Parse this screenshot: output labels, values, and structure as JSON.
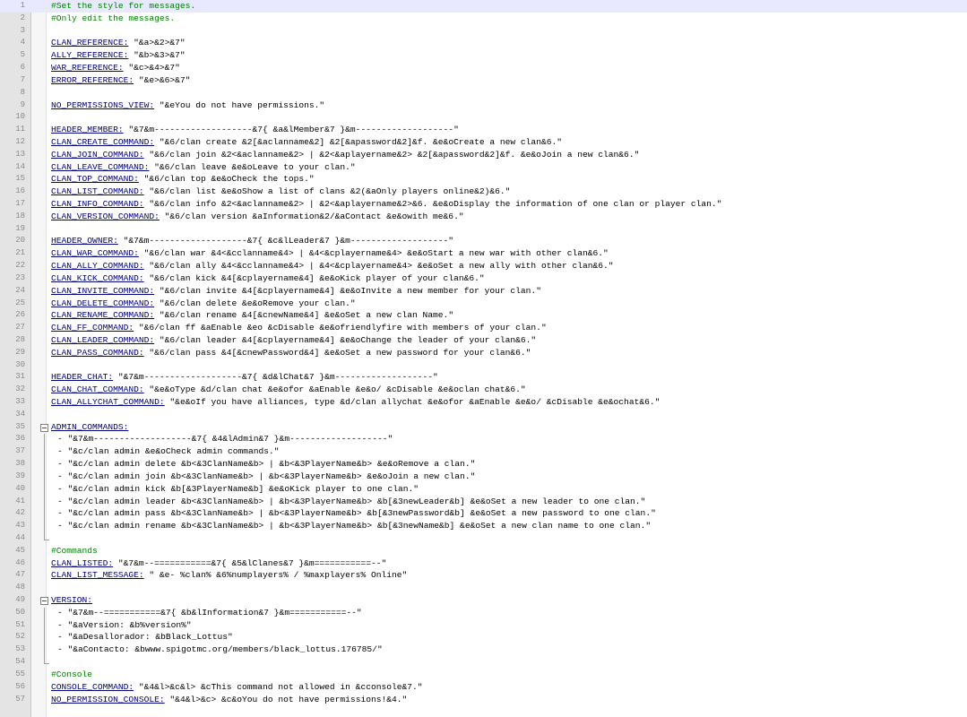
{
  "colors": {
    "comment": "#008000",
    "key": "#000080",
    "text": "#000000",
    "current_line": "#e8e8ff",
    "gutter": "#e4e4e4"
  },
  "lines": [
    {
      "n": "1",
      "type": "comment",
      "text": "#Set the style for messages.",
      "current": true
    },
    {
      "n": "2",
      "type": "comment",
      "text": "#Only edit the messages."
    },
    {
      "n": "3",
      "type": "blank",
      "text": ""
    },
    {
      "n": "4",
      "type": "kv",
      "key": "CLAN_REFERENCE:",
      "value": " \"&a>&2>&7\""
    },
    {
      "n": "5",
      "type": "kv",
      "key": "ALLY_REFERENCE:",
      "value": " \"&b>&3>&7\""
    },
    {
      "n": "6",
      "type": "kv",
      "key": "WAR_REFERENCE:",
      "value": " \"&c>&4>&7\""
    },
    {
      "n": "7",
      "type": "kv",
      "key": "ERROR_REFERENCE:",
      "value": " \"&e>&6>&7\""
    },
    {
      "n": "8",
      "type": "blank",
      "text": ""
    },
    {
      "n": "9",
      "type": "kv",
      "key": "NO_PERMISSIONS_VIEW:",
      "value": " \"&eYou do not have permissions.\""
    },
    {
      "n": "10",
      "type": "blank",
      "text": ""
    },
    {
      "n": "11",
      "type": "kv",
      "key": "HEADER_MEMBER:",
      "value": " \"&7&m-------------------&7{ &a&lMember&7 }&m-------------------\""
    },
    {
      "n": "12",
      "type": "kv",
      "key": "CLAN_CREATE_COMMAND:",
      "value": " \"&6/clan create &2[&aclanname&2] &2[&apassword&2]&f. &e&oCreate a new clan&6.\""
    },
    {
      "n": "13",
      "type": "kv",
      "key": "CLAN_JOIN_COMMAND:",
      "value": " \"&6/clan join &2<&aclanname&2> | &2<&aplayername&2> &2[&apassword&2]&f. &e&oJoin a new clan&6.\""
    },
    {
      "n": "14",
      "type": "kv",
      "key": "CLAN_LEAVE_COMMAND:",
      "value": " \"&6/clan leave &e&oLeave to your clan.\""
    },
    {
      "n": "15",
      "type": "kv",
      "key": "CLAN_TOP_COMMAND:",
      "value": " \"&6/clan top &e&oCheck the tops.\""
    },
    {
      "n": "16",
      "type": "kv",
      "key": "CLAN_LIST_COMMAND:",
      "value": " \"&6/clan list &e&oShow a list of clans &2(&aOnly players online&2)&6.\""
    },
    {
      "n": "17",
      "type": "kv",
      "key": "CLAN_INFO_COMMAND:",
      "value": " \"&6/clan info &2<&aclanname&2> | &2<&aplayername&2>&6. &e&oDisplay the information of one clan or player clan.\""
    },
    {
      "n": "18",
      "type": "kv",
      "key": "CLAN_VERSION_COMMAND:",
      "value": " \"&6/clan version &aInformation&2/&aContact &e&owith me&6.\""
    },
    {
      "n": "19",
      "type": "blank",
      "text": ""
    },
    {
      "n": "20",
      "type": "kv",
      "key": "HEADER_OWNER:",
      "value": " \"&7&m-------------------&7{ &c&lLeader&7 }&m-------------------\""
    },
    {
      "n": "21",
      "type": "kv",
      "key": "CLAN_WAR_COMMAND:",
      "value": " \"&6/clan war &4<&cclanname&4> | &4<&cplayername&4> &e&oStart a new war with other clan&6.\""
    },
    {
      "n": "22",
      "type": "kv",
      "key": "CLAN_ALLY_COMMAND:",
      "value": " \"&6/clan ally &4<&cclanname&4> | &4<&cplayername&4> &e&oSet a new ally with other clan&6.\""
    },
    {
      "n": "23",
      "type": "kv",
      "key": "CLAN_KICK_COMMAND:",
      "value": " \"&6/clan kick &4[&cplayername&4] &e&oKick player of your clan&6.\""
    },
    {
      "n": "24",
      "type": "kv",
      "key": "CLAN_INVITE_COMMAND:",
      "value": " \"&6/clan invite &4[&cplayername&4] &e&oInvite a new member for your clan.\""
    },
    {
      "n": "25",
      "type": "kv",
      "key": "CLAN_DELETE_COMMAND:",
      "value": " \"&6/clan delete &e&oRemove your clan.\""
    },
    {
      "n": "26",
      "type": "kv",
      "key": "CLAN_RENAME_COMMAND:",
      "value": " \"&6/clan rename &4[&cnewName&4] &e&oSet a new clan Name.\""
    },
    {
      "n": "27",
      "type": "kv",
      "key": "CLAN_FF_COMMAND:",
      "value": " \"&6/clan ff &aEnable &eo &cDisable &e&ofriendlyfire with members of your clan.\""
    },
    {
      "n": "28",
      "type": "kv",
      "key": "CLAN_LEADER_COMMAND:",
      "value": " \"&6/clan leader &4[&cplayername&4] &e&oChange the leader of your clan&6.\""
    },
    {
      "n": "29",
      "type": "kv",
      "key": "CLAN_PASS_COMMAND:",
      "value": " \"&6/clan pass &4[&cnewPassword&4] &e&oSet a new password for your clan&6.\""
    },
    {
      "n": "30",
      "type": "blank",
      "text": ""
    },
    {
      "n": "31",
      "type": "kv",
      "key": "HEADER_CHAT:",
      "value": " \"&7&m-------------------&7{ &d&lChat&7 }&m-------------------\""
    },
    {
      "n": "32",
      "type": "kv",
      "key": "CLAN_CHAT_COMMAND:",
      "value": " \"&e&oType &d/clan chat &e&ofor &aEnable &e&o/ &cDisable &e&oclan chat&6.\""
    },
    {
      "n": "33",
      "type": "kv",
      "key": "CLAN_ALLYCHAT_COMMAND:",
      "value": " \"&e&oIf you have alliances, type &d/clan allychat &e&ofor &aEnable &e&o/ &cDisable &e&ochat&6.\""
    },
    {
      "n": "34",
      "type": "blank",
      "text": ""
    },
    {
      "n": "35",
      "type": "fold",
      "key": "ADMIN_COMMANDS:",
      "value": ""
    },
    {
      "n": "36",
      "type": "item",
      "text": "- \"&7&m-------------------&7{ &4&lAdmin&7 }&m-------------------\""
    },
    {
      "n": "37",
      "type": "item",
      "text": "- \"&c/clan admin &e&oCheck admin commands.\""
    },
    {
      "n": "38",
      "type": "item",
      "text": "- \"&c/clan admin delete &b<&3ClanName&b> | &b<&3PlayerName&b> &e&oRemove a clan.\""
    },
    {
      "n": "39",
      "type": "item",
      "text": "- \"&c/clan admin join &b<&3ClanName&b> | &b<&3PlayerName&b> &e&oJoin a new clan.\""
    },
    {
      "n": "40",
      "type": "item",
      "text": "- \"&c/clan admin kick &b[&3PlayerName&b] &e&oKick player to one clan.\""
    },
    {
      "n": "41",
      "type": "item",
      "text": "- \"&c/clan admin leader &b<&3ClanName&b> | &b<&3PlayerName&b> &b[&3newLeader&b] &e&oSet a new leader to one clan.\""
    },
    {
      "n": "42",
      "type": "item",
      "text": "- \"&c/clan admin pass &b<&3ClanName&b> | &b<&3PlayerName&b> &b[&3newPassword&b] &e&oSet a new password to one clan.\""
    },
    {
      "n": "43",
      "type": "item",
      "text": "- \"&c/clan admin rename &b<&3ClanName&b> | &b<&3PlayerName&b> &b[&3newName&b] &e&oSet a new clan name to one clan.\""
    },
    {
      "n": "44",
      "type": "blank",
      "text": ""
    },
    {
      "n": "45",
      "type": "comment",
      "text": "#Commands"
    },
    {
      "n": "46",
      "type": "kv",
      "key": "CLAN_LISTED:",
      "value": " \"&7&m--===========&7{ &5&lClanes&7 }&m===========--\""
    },
    {
      "n": "47",
      "type": "kv",
      "key": "CLAN_LIST_MESSAGE:",
      "value": " \" &e- %clan% &6%numplayers% / %maxplayers% Online\""
    },
    {
      "n": "48",
      "type": "blank",
      "text": ""
    },
    {
      "n": "49",
      "type": "fold",
      "key": "VERSION:",
      "value": ""
    },
    {
      "n": "50",
      "type": "item",
      "text": "- \"&7&m--===========&7{ &b&lInformation&7 }&m===========--\""
    },
    {
      "n": "51",
      "type": "item",
      "text": "- \"&aVersion: &b%version%\""
    },
    {
      "n": "52",
      "type": "item",
      "text": "- \"&aDesallorador: &bBlack_Lottus\""
    },
    {
      "n": "53",
      "type": "item",
      "text": "- \"&aContacto: &bwww.spigotmc.org/members/black_lottus.176785/\""
    },
    {
      "n": "54",
      "type": "blank",
      "text": ""
    },
    {
      "n": "55",
      "type": "comment",
      "text": "#Console"
    },
    {
      "n": "56",
      "type": "kv",
      "key": "CONSOLE_COMMAND:",
      "value": " \"&4&l>&c&l> &cThis command not allowed in &cconsole&7.\""
    },
    {
      "n": "57",
      "type": "kv",
      "key": "NO_PERMISSION_CONSOLE:",
      "value": " \"&4&l>&c> &c&oYou do not have permissions!&4.\""
    }
  ]
}
